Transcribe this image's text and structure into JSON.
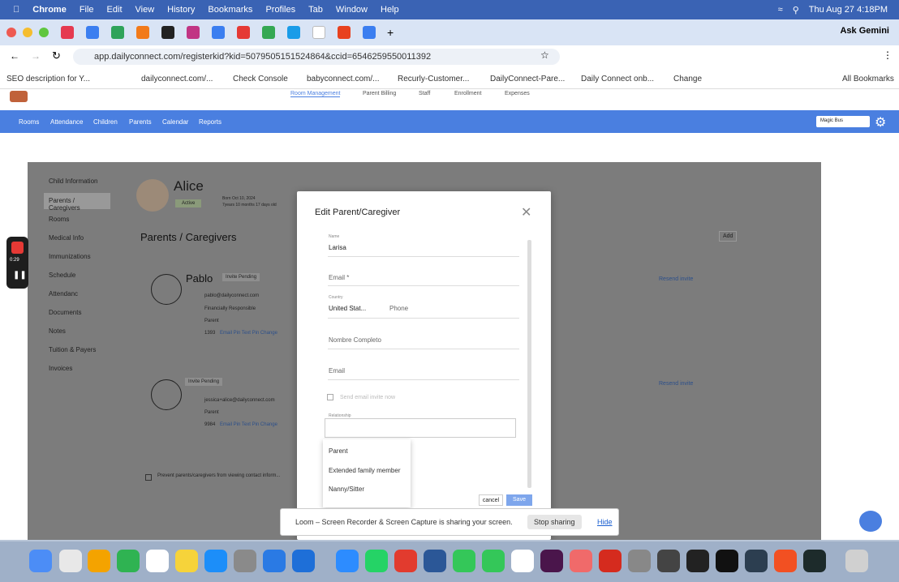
{
  "menubar": {
    "app": "Chrome",
    "items": [
      "File",
      "Edit",
      "View",
      "History",
      "Bookmarks",
      "Profiles",
      "Tab",
      "Window",
      "Help"
    ],
    "clock": "Thu Aug 27  4:18PM"
  },
  "tabs": {
    "ask": "Ask Gemini"
  },
  "address": {
    "url": "app.dailyconnect.com/registerkid?kid=5079505151524864&ccid=6546259550011392"
  },
  "bookmarks": [
    "SEO description for Y...",
    "dailyconnect.com/...",
    "Check Console",
    "babyconnect.com/...",
    "Recurly-Customer...",
    "DailyConnect-Pare...",
    "Daily Connect onb...",
    "Change"
  ],
  "bookmarks_all": "All Bookmarks",
  "topnav": [
    "Room Management",
    "Parent Billing",
    "Staff",
    "Enrollment",
    "Expenses"
  ],
  "subnav": [
    "Rooms",
    "Attendance",
    "Children",
    "Parents",
    "Calendar",
    "Reports"
  ],
  "school": "Magic Bus",
  "sidebar": [
    "Child Information",
    "Parents / Caregivers",
    "Rooms",
    "Medical Info",
    "Immunizations",
    "Schedule",
    "Attendanc",
    "Documents",
    "Notes",
    "Tuition & Payers",
    "Invoices"
  ],
  "child": {
    "name": "Alice",
    "status": "Active",
    "born": "Born Oct 10, 2024",
    "age": "7years 10 months 17 days old"
  },
  "section_title": "Parents / Caregivers",
  "add": "Add",
  "parent1": {
    "name": "Pablo",
    "badge": "Invite Pending",
    "email": "pablo@dailyconnect.com",
    "financial": "Financially Responsible",
    "role": "Parent",
    "pin": "1393",
    "links": "Email Pin   Text Pin   Change",
    "resend": "Resend invite"
  },
  "parent2": {
    "badge": "Invite Pending",
    "email": "jessica+alice@dailyconnect.com",
    "role": "Parent",
    "pin": "9984",
    "links": "Email Pin   Text Pin   Change",
    "resend": "Resend invite"
  },
  "prevent": "Prevent parents/caregivers from viewing contact inform...",
  "modal": {
    "title": "Edit Parent/Caregiver",
    "name_label": "Name",
    "name_value": "Larisa",
    "email_label": "Email *",
    "country_label": "Country",
    "country_value": "United Stat...",
    "phone_placeholder": "Phone",
    "fullname_placeholder": "Nombre Completo",
    "email2_placeholder": "Email",
    "send_invite": "Send email invite now",
    "relationship_label": "Relationship",
    "cancel": "cancel",
    "save": "Save"
  },
  "dropdown": [
    "Parent",
    "Extended family member",
    "Nanny/Sitter"
  ],
  "recorder_time": "0:29",
  "loom": {
    "text": "Loom – Screen Recorder & Screen Capture is sharing your screen.",
    "stop": "Stop sharing",
    "hide": "Hide"
  }
}
